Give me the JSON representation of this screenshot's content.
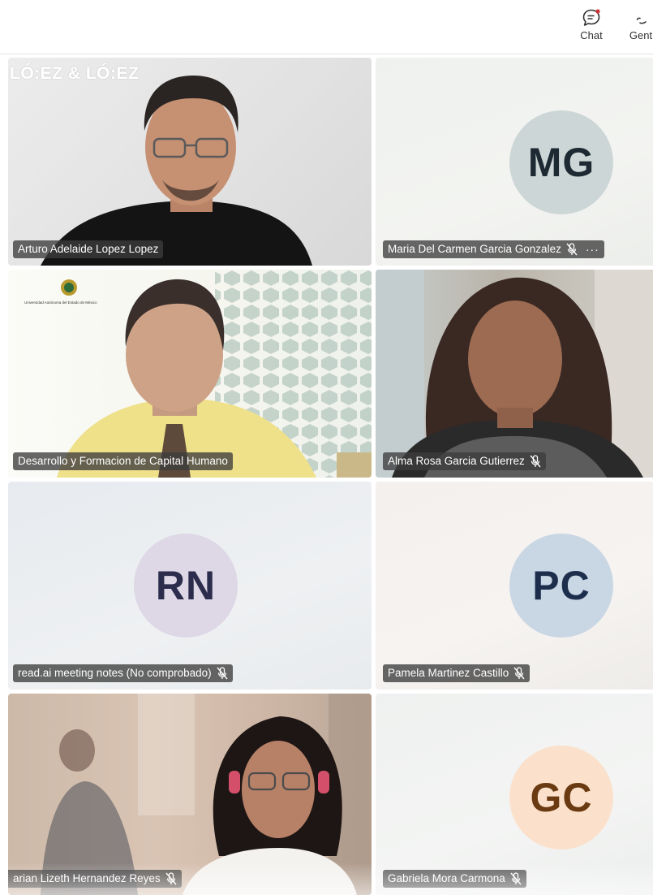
{
  "toolbar": {
    "chat_label": "Chat",
    "people_label": "Gent"
  },
  "colors": {
    "avatar_mg_bg": "#cdd6d6",
    "avatar_mg_fg": "#1d2a33",
    "avatar_rn_bg": "#ddd7e6",
    "avatar_rn_fg": "#2c2d4c",
    "avatar_pc_bg": "#c9d6e3",
    "avatar_pc_fg": "#1d2e4c",
    "avatar_gc_bg": "#fbe1cb",
    "avatar_gc_fg": "#6a3a12"
  },
  "participants": [
    {
      "name": "Arturo Adelaide Lopez Lopez",
      "muted": false,
      "video": true,
      "background_logo": "LÓ:EZ & LÓ:EZ"
    },
    {
      "name": "Maria Del Carmen Garcia Gonzalez",
      "muted": true,
      "video": false,
      "initials": "MG",
      "more_options": "···"
    },
    {
      "name": "Desarrollo y Formacion de Capital Humano",
      "muted": false,
      "video": true,
      "background_caption": "Universidad Autónoma del Estado de México"
    },
    {
      "name": "Alma Rosa Garcia Gutierrez",
      "muted": true,
      "video": true
    },
    {
      "name": "read.ai meeting notes (No comprobado)",
      "muted": true,
      "video": false,
      "initials": "RN"
    },
    {
      "name": "Pamela Martinez Castillo",
      "muted": true,
      "video": false,
      "initials": "PC"
    },
    {
      "name": "arian Lizeth Hernandez Reyes",
      "muted": true,
      "video": true
    },
    {
      "name": "Gabriela Mora Carmona",
      "muted": true,
      "video": false,
      "initials": "GC"
    }
  ]
}
